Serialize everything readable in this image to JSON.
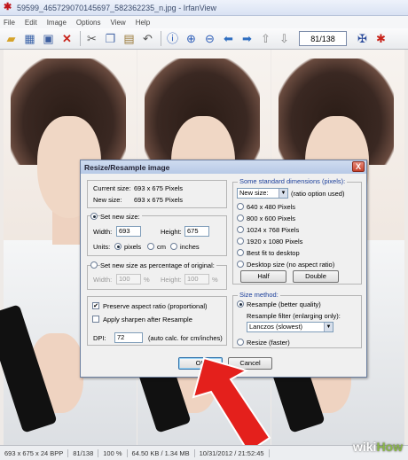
{
  "window": {
    "title": "59599_465729070145697_582362235_n.jpg - IrfanView"
  },
  "menu": [
    "File",
    "Edit",
    "Image",
    "Options",
    "View",
    "Help"
  ],
  "toolbar": {
    "icons": [
      "open-folder-icon",
      "slideshow-icon",
      "save-icon",
      "delete-icon",
      "cut-icon",
      "copy-icon",
      "paste-icon",
      "undo-icon",
      "info-icon",
      "zoom-in-icon",
      "zoom-out-icon",
      "prev-icon",
      "next-icon",
      "first-icon",
      "last-icon",
      "settings-icon",
      "irfan-icon"
    ],
    "page_counter": "81/138"
  },
  "dialog": {
    "title": "Resize/Resample image",
    "close": "X",
    "current_size_label": "Current size:",
    "current_size_value": "693  x  675  Pixels",
    "new_size_label": "New size:",
    "new_size_value": "693  x  675  Pixels",
    "set_new_size": "Set new size:",
    "width_label": "Width:",
    "width_value": "693",
    "height_label": "Height:",
    "height_value": "675",
    "units_label": "Units:",
    "units": [
      "pixels",
      "cm",
      "inches"
    ],
    "set_percentage": "Set new size as percentage of original:",
    "pct_width_label": "Width:",
    "pct_width_value": "100",
    "pct_height_label": "Height:",
    "pct_height_value": "100",
    "pct_sign": "%",
    "preserve_aspect": "Preserve aspect ratio (proportional)",
    "apply_sharpen": "Apply sharpen after Resample",
    "dpi_label": "DPI:",
    "dpi_value": "72",
    "dpi_note": "(auto calc. for cm/inches)",
    "standard_title": "Some standard dimensions (pixels):",
    "standard_select": "New size:",
    "ratio_note": "(ratio option used)",
    "standard_options": [
      "640 x 480 Pixels",
      "800 x 600 Pixels",
      "1024 x 768 Pixels",
      "1920 x 1080 Pixels",
      "Best fit to desktop",
      "Desktop size (no aspect ratio)"
    ],
    "half": "Half",
    "double": "Double",
    "size_method_title": "Size method:",
    "resample": "Resample (better quality)",
    "filter_label": "Resample filter (enlarging only):",
    "filter_value": "Lanczos (slowest)",
    "resize": "Resize (faster)",
    "ok": "OK",
    "cancel": "Cancel"
  },
  "status": [
    "693 x 675 x 24 BPP",
    "81/138",
    "100 %",
    "64.50 KB / 1.34 MB",
    "10/31/2012 / 21:52:45"
  ],
  "watermark": {
    "brand1": "wiki",
    "brand2": "How"
  }
}
